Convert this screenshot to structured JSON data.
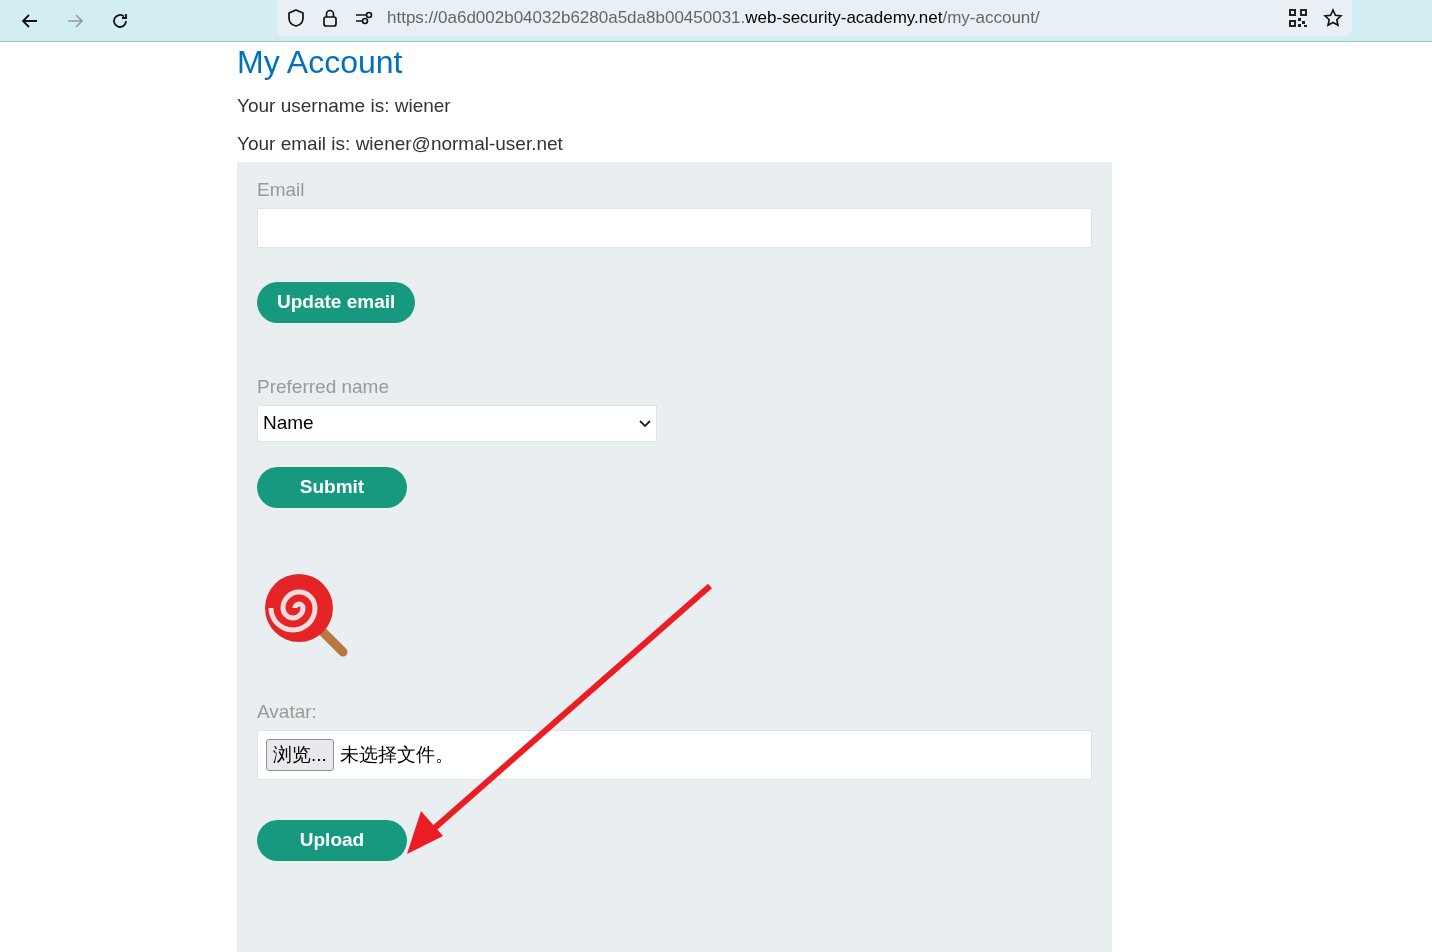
{
  "browser": {
    "url": {
      "prefix": "https://0a6d002b04032b6280a5da8b00450031.",
      "domain": "web-security-academy.net",
      "path": "/my-account/"
    }
  },
  "page": {
    "heading": "My Account",
    "username_line": "Your username is: wiener",
    "email_line": "Your email is: wiener@normal-user.net"
  },
  "email_form": {
    "label": "Email",
    "button": "Update email"
  },
  "name_form": {
    "label": "Preferred name",
    "select_value": "Name",
    "button": "Submit"
  },
  "avatar_form": {
    "label": "Avatar:",
    "browse_button": "浏览...",
    "file_status": "未选择文件。",
    "button": "Upload"
  }
}
